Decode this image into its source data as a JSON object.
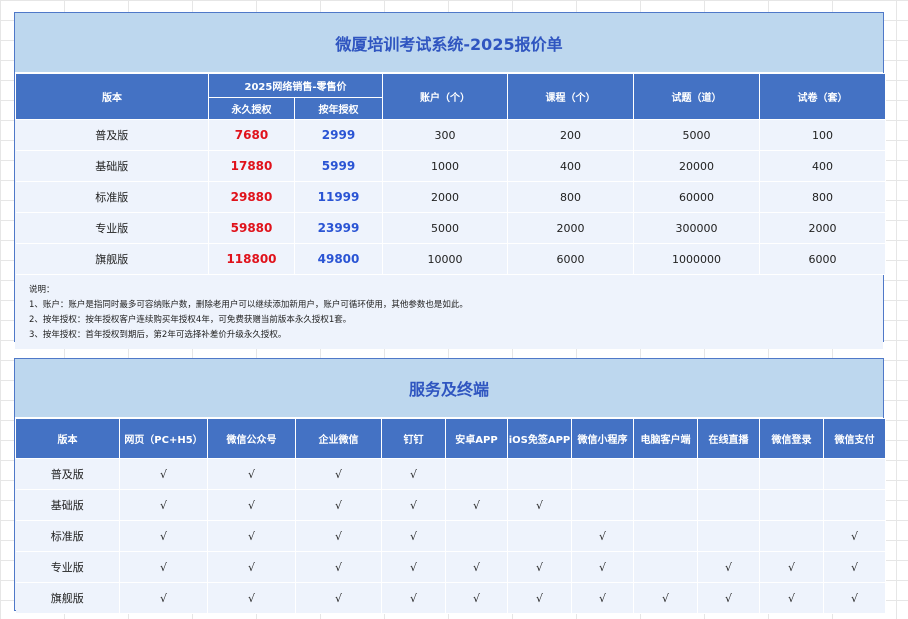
{
  "pricing": {
    "title": "微厦培训考试系统-2025报价单",
    "headers": {
      "version": "版本",
      "price_group": "2025网络销售-零售价",
      "perpetual": "永久授权",
      "annual": "按年授权",
      "accounts": "账户（个）",
      "courses": "课程（个）",
      "questions": "试题（道）",
      "papers": "试卷（套）"
    },
    "rows": [
      {
        "version": "普及版",
        "perpetual": "7680",
        "annual": "2999",
        "accounts": "300",
        "courses": "200",
        "questions": "5000",
        "papers": "100"
      },
      {
        "version": "基础版",
        "perpetual": "17880",
        "annual": "5999",
        "accounts": "1000",
        "courses": "400",
        "questions": "20000",
        "papers": "400"
      },
      {
        "version": "标准版",
        "perpetual": "29880",
        "annual": "11999",
        "accounts": "2000",
        "courses": "800",
        "questions": "60000",
        "papers": "800"
      },
      {
        "version": "专业版",
        "perpetual": "59880",
        "annual": "23999",
        "accounts": "5000",
        "courses": "2000",
        "questions": "300000",
        "papers": "2000"
      },
      {
        "version": "旗舰版",
        "perpetual": "118800",
        "annual": "49800",
        "accounts": "10000",
        "courses": "6000",
        "questions": "1000000",
        "papers": "6000"
      }
    ],
    "notes": [
      "说明：",
      "1、账户：账户是指同时最多可容纳账户数，删除老用户可以继续添加新用户，账户可循环使用，其他参数也是如此。",
      "2、按年授权：按年授权客户连续购买年授权4年，可免费获赠当前版本永久授权1套。",
      "3、按年授权：首年授权到期后，第2年可选择补差价升级永久授权。"
    ]
  },
  "services": {
    "title": "服务及终端",
    "headers": [
      "版本",
      "网页（PC+H5）",
      "微信公众号",
      "企业微信",
      "钉钉",
      "安卓APP",
      "iOS免签APP",
      "微信小程序",
      "电脑客户端",
      "在线直播",
      "微信登录",
      "微信支付"
    ],
    "check_mark": "√",
    "rows": [
      {
        "version": "普及版",
        "checks": [
          1,
          1,
          1,
          1,
          0,
          0,
          0,
          0,
          0,
          0,
          0
        ]
      },
      {
        "version": "基础版",
        "checks": [
          1,
          1,
          1,
          1,
          1,
          1,
          0,
          0,
          0,
          0,
          0
        ]
      },
      {
        "version": "标准版",
        "checks": [
          1,
          1,
          1,
          1,
          0,
          0,
          1,
          0,
          0,
          0,
          1
        ]
      },
      {
        "version": "专业版",
        "checks": [
          1,
          1,
          1,
          1,
          1,
          1,
          1,
          0,
          1,
          1,
          1
        ]
      },
      {
        "version": "旗舰版",
        "checks": [
          1,
          1,
          1,
          1,
          1,
          1,
          1,
          1,
          1,
          1,
          1
        ]
      }
    ]
  },
  "colors": {
    "header_blue": "#4472c4",
    "title_bg": "#bdd7ee",
    "title_text": "#2f55c0",
    "perpetual_red": "#e0121b",
    "annual_blue": "#2a54d4",
    "row_bg": "#eef3fc"
  }
}
